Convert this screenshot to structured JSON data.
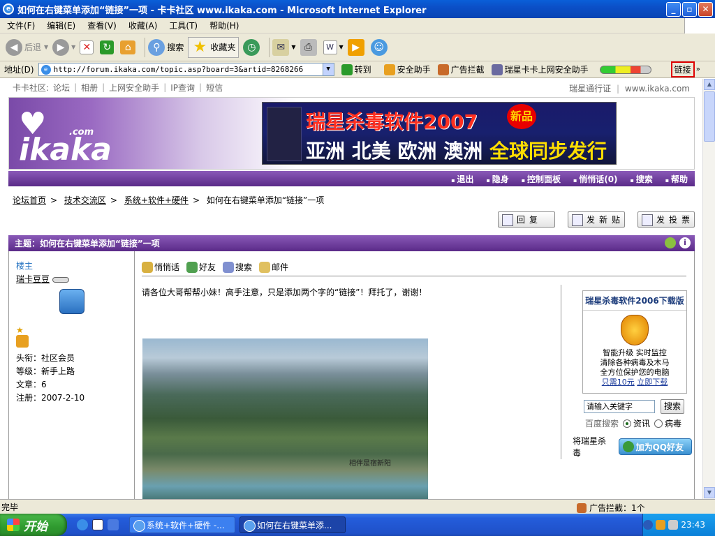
{
  "window": {
    "title": "如何在右键菜单添加“链接”一项 - 卡卡社区 www.ikaka.com - Microsoft Internet Explorer"
  },
  "menu": [
    "文件(F)",
    "编辑(E)",
    "查看(V)",
    "收藏(A)",
    "工具(T)",
    "帮助(H)"
  ],
  "toolbar": {
    "back": "后退",
    "search": "搜索",
    "favorites": "收藏夹"
  },
  "address": {
    "label": "地址(D)",
    "url": "http://forum.ikaka.com/topic.asp?board=3&artid=8268266",
    "go": "转到",
    "security": "安全助手",
    "adblock": "广告拦截",
    "ruixing": "瑞星卡卡上网安全助手",
    "links": "链接"
  },
  "topnav": {
    "prefix": "卡卡社区:",
    "items": [
      "论坛",
      "相册",
      "上网安全助手",
      "IP查询",
      "短信"
    ],
    "right1": "瑞星通行证",
    "right2": "www.ikaka.com"
  },
  "banner": {
    "ad_line1": "瑞星杀毒软件2007",
    "ad_new": "新品",
    "ad_line2a": "亚洲 北美 欧洲 澳洲",
    "ad_line2b": "全球同步发行"
  },
  "forumnav": [
    "退出",
    "隐身",
    "控制面板",
    "悄悄话(0)",
    "搜索",
    "帮助"
  ],
  "breadcrumb": {
    "home": "论坛首页",
    "section": "技术交流区",
    "board": "系统+软件+硬件",
    "current": "如何在右键菜单添加“链接”一项"
  },
  "buttons": {
    "reply": "回复",
    "new_post": "发新贴",
    "new_vote": "发投票"
  },
  "topic": {
    "title": "主题：如何在右键菜单添加“链接”一项"
  },
  "user": {
    "role": "楼主",
    "name": "瑞卡豆豆",
    "title": "头衔：社区会员",
    "level": "等级：新手上路",
    "posts": "文章：6",
    "registered": "注册：2007-2-10"
  },
  "post_actions": [
    "悄悄话",
    "好友",
    "搜索",
    "邮件"
  ],
  "post": {
    "message": "请各位大哥帮帮小妹！高手注意，只是添加两个字的“链接”！拜托了，谢谢！",
    "watermark": "相伴是宿新阳"
  },
  "sidebar": {
    "box_title": "瑞星杀毒软件2006下载版",
    "line1": "智能升级 实时监控",
    "line2": "清除各种病毒及木马",
    "line3": "全方位保护您的电脑",
    "price": "只需10元",
    "download": "立即下载",
    "keyword_placeholder": "请输入关键字",
    "search_btn": "搜索",
    "baidu": "百度搜索",
    "opt1": "资讯",
    "opt2": "病毒",
    "qq_prefix": "将瑞星杀毒",
    "qq_btn": "加为QQ好友"
  },
  "status": {
    "text": "完毕",
    "adblock": "广告拦截：1个"
  },
  "taskbar": {
    "start": "开始",
    "task1": "系统+软件+硬件 -...",
    "task2": "如何在右键菜单添...",
    "clock": "23:43"
  }
}
